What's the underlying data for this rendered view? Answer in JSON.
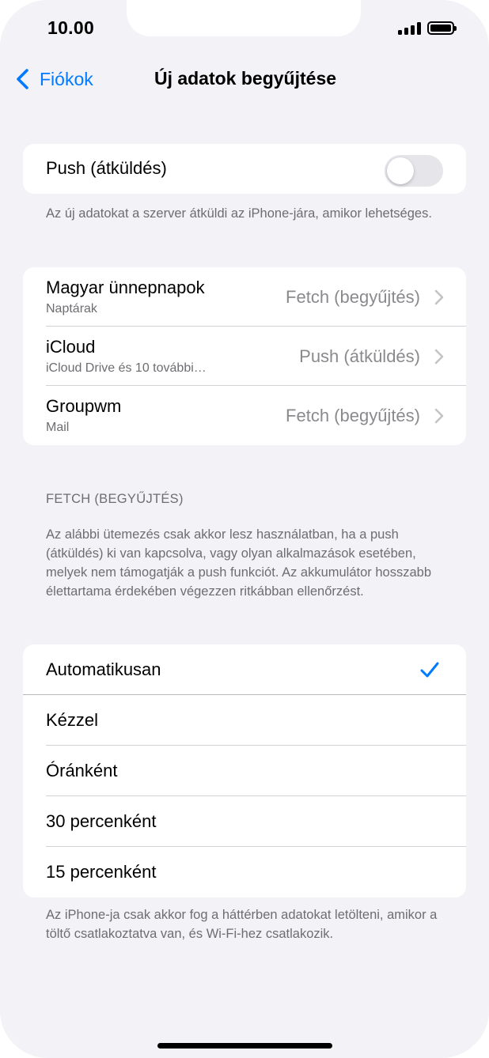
{
  "status_bar": {
    "time": "10.00"
  },
  "nav": {
    "back_label": "Fiókok",
    "title": "Új adatok begyűjtése"
  },
  "push": {
    "label": "Push (átküldés)",
    "enabled": false,
    "footer": "Az új adatokat a szerver átküldi az iPhone-jára, amikor lehetséges."
  },
  "accounts": [
    {
      "name": "Magyar ünnepnapok",
      "detail": "Naptárak",
      "value": "Fetch (begyűjtés)"
    },
    {
      "name": "iCloud",
      "detail": "iCloud Drive és 10 további…",
      "value": "Push (átküldés)"
    },
    {
      "name": "Groupwm",
      "detail": "Mail",
      "value": "Fetch (begyűjtés)"
    }
  ],
  "fetch": {
    "header": "FETCH (BEGYŰJTÉS)",
    "description": "Az alábbi ütemezés csak akkor lesz használatban, ha a push (átküldés) ki van kapcsolva, vagy olyan alkalmazások esetében, melyek nem támogatják a push funkciót. Az akkumulátor hosszabb élettartama érdekében végezzen ritkábban ellenőrzést.",
    "options": [
      "Automatikusan",
      "Kézzel",
      "Óránként",
      "30 percenként",
      "15 percenként"
    ],
    "selected": "Automatikusan",
    "footer": "Az iPhone-ja csak akkor fog a háttérben adatokat letölteni, amikor a töltő csatlakoztatva van, és Wi-Fi-hez csatlakozik."
  },
  "colors": {
    "accent": "#007aff",
    "background": "#f2f2f7",
    "secondary_text": "#6d6d72"
  }
}
